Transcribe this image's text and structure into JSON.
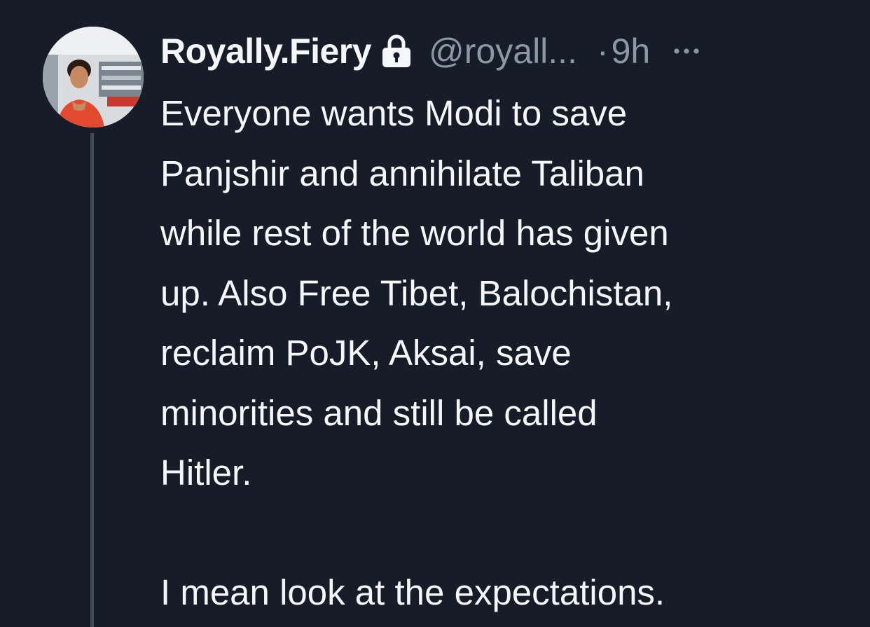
{
  "tweet": {
    "display_name": "Royally.Fiery",
    "handle": "@royall...",
    "separator": "·",
    "time": "9h",
    "protected_icon": "lock-icon",
    "more_icon": "more-horizontal-icon",
    "text_lines": [
      "Everyone wants Modi to save",
      "Panjshir and annihilate Taliban",
      "while rest of the world has given",
      "up. Also Free Tibet, Balochistan,",
      "reclaim PoJK, Aksai, save",
      "minorities and still be called",
      "Hitler.",
      "",
      "I mean look at the expectations."
    ]
  },
  "colors": {
    "background": "#161d29",
    "primary_text": "#f4f6f8",
    "secondary_text": "#8b98a5",
    "thread_line": "#3f4b59"
  }
}
